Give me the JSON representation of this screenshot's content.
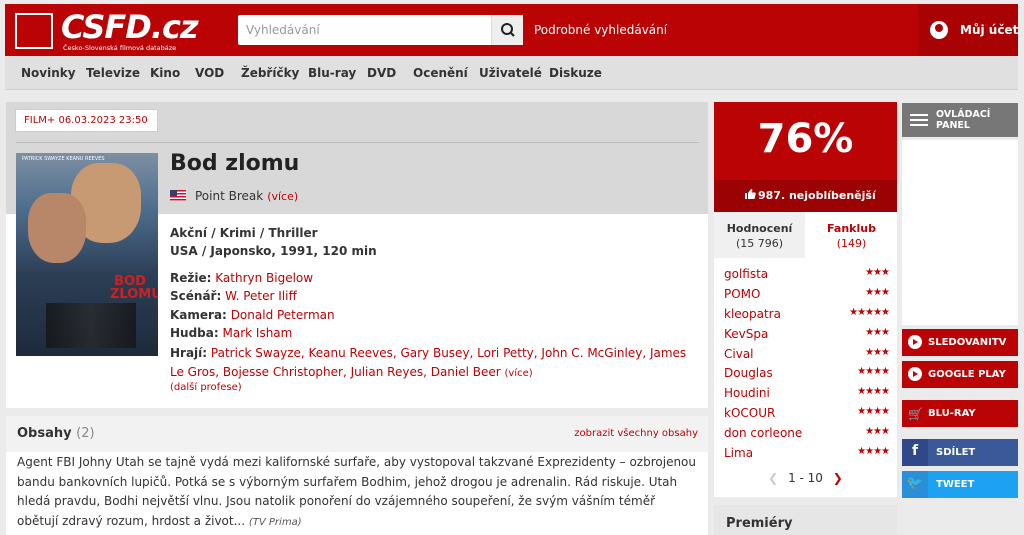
{
  "header": {
    "logo_text": "CSFD.cz",
    "logo_tagline": "Česko-Slovenská filmová databáze",
    "search_placeholder": "Vyhledávání",
    "advanced_search": "Podrobné vyhledávání",
    "account": "Můj účet"
  },
  "nav": [
    "Novinky",
    "Televize",
    "Kino",
    "VOD",
    "Žebříčky",
    "Blu-ray",
    "DVD",
    "Ocenění",
    "Uživatelé",
    "Diskuze"
  ],
  "film": {
    "badge": "FILM+ 06.03.2023 23:50",
    "title": "Bod zlomu",
    "alt_title": "Point Break",
    "alt_more": "(více)",
    "genre": "Akční / Krimi / Thriller",
    "origin": "USA / Japonsko, 1991, 120 min",
    "director_label": "Režie:",
    "director": "Kathryn Bigelow",
    "writer_label": "Scénář:",
    "writer": "W. Peter Iliff",
    "camera_label": "Kamera:",
    "camera": "Donald Peterman",
    "music_label": "Hudba:",
    "music": "Mark Isham",
    "cast_label": "Hrají:",
    "cast": "Patrick Swayze, Keanu Reeves, Gary Busey, Lori Petty, John C. McGinley, James Le Gros, Bojesse Christopher, Julian Reyes, Daniel Beer",
    "cast_more": "(více)",
    "more_professions": "(další profese)",
    "poster_names": "PATRICK SWAYZE   KEANU REEVES",
    "poster_title": "BOD ZLOMU"
  },
  "plot": {
    "title": "Obsahy",
    "count": "(2)",
    "show_all": "zobrazit všechny obsahy",
    "text": "Agent FBI Johny Utah se tajně vydá mezi kalifornské surfaře, aby vystopoval takzvané Exprezidenty – ozbrojenou bandu bankovních lupičů. Potká se s výborným surfařem Bodhim, jehož drogou je adrenalin. Rád riskuje. Utah hledá pravdu, Bodhi největší vlnu. Jsou natolik ponoření do vzájemného soupeření, že svým vášním téměř obětují zdravý rozum, hrdost a život...",
    "source": "(TV Prima)"
  },
  "rating": {
    "value": "76%",
    "rank": "987. nejoblíbenější",
    "tab_ratings_label": "Hodnocení",
    "tab_ratings_count": "(15 796)",
    "tab_fanclub_label": "Fanklub",
    "tab_fanclub_count": "(149)",
    "users": [
      {
        "name": "golfista",
        "stars": 3
      },
      {
        "name": "POMO",
        "stars": 3
      },
      {
        "name": "kleopatra",
        "stars": 5
      },
      {
        "name": "KevSpa",
        "stars": 3
      },
      {
        "name": "Cival",
        "stars": 3
      },
      {
        "name": "Douglas",
        "stars": 4
      },
      {
        "name": "Houdini",
        "stars": 4
      },
      {
        "name": "kOCOUR",
        "stars": 4
      },
      {
        "name": "don corleone",
        "stars": 3
      },
      {
        "name": "Lima",
        "stars": 4
      }
    ],
    "pager": "1 - 10"
  },
  "premiery": "Premiéry",
  "sidebar": {
    "control_panel": "OVLÁDACÍ PANEL",
    "sledovanitv": "SLEDOVANITV",
    "google_play": "GOOGLE PLAY",
    "bluray": "BLU-RAY",
    "share": "SDÍLET",
    "tweet": "TWEET"
  },
  "colors": {
    "brand_red": "#ba0305",
    "facebook": "#3b5998",
    "twitter": "#1da1f2"
  }
}
